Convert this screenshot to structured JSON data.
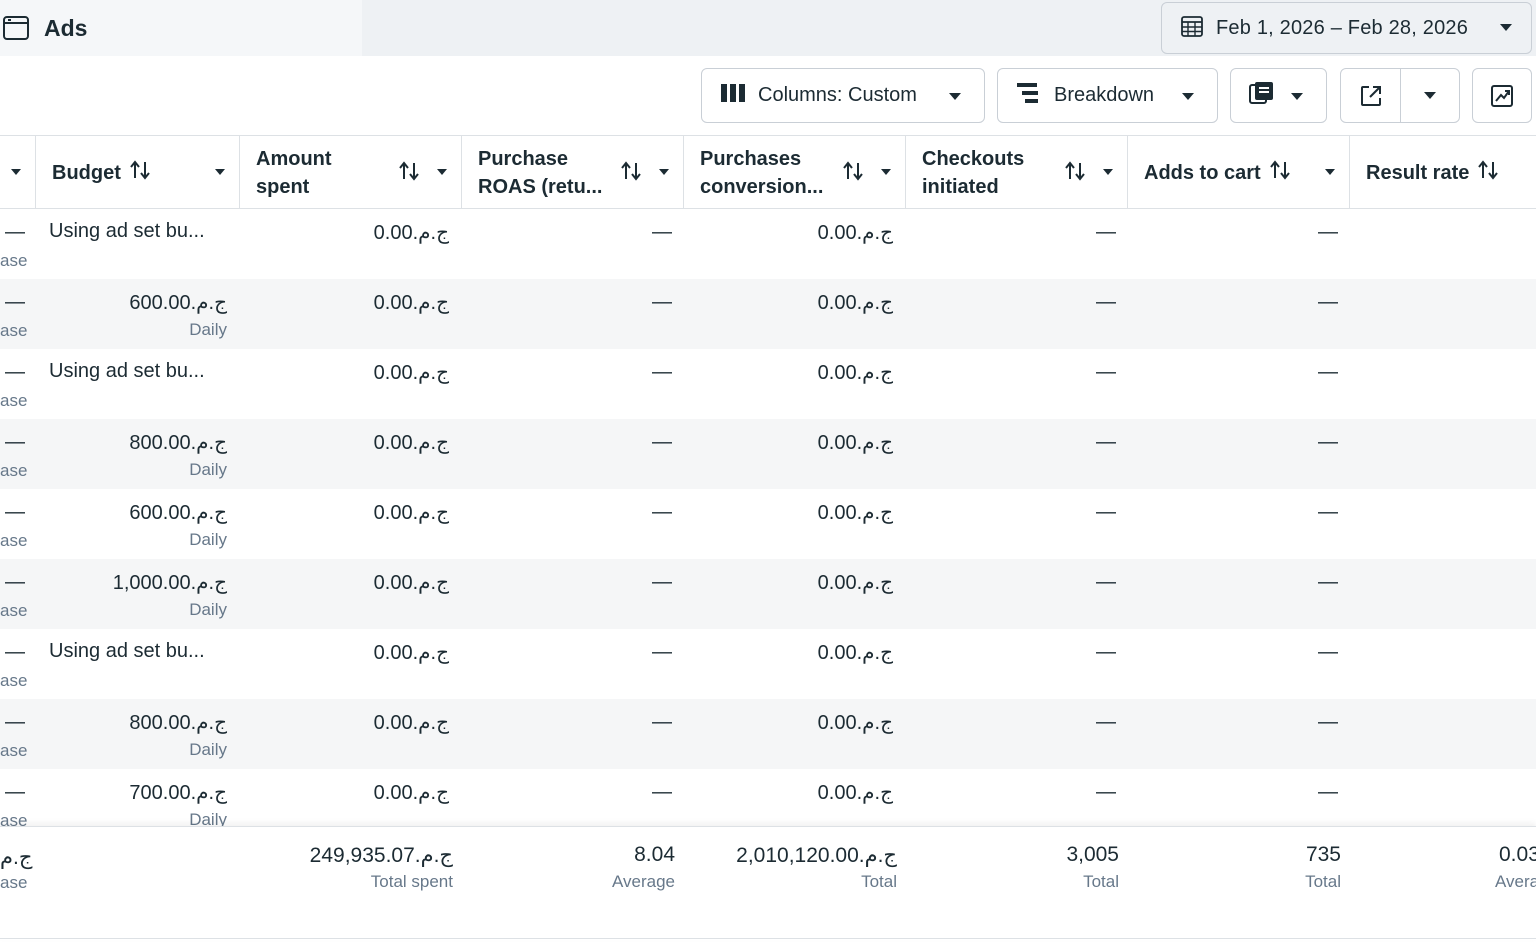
{
  "header": {
    "title": "Ads",
    "date_range": "Feb 1, 2026 – Feb 28, 2026"
  },
  "toolbar": {
    "columns_label": "Columns: Custom",
    "breakdown_label": "Breakdown"
  },
  "table": {
    "columns": [
      {
        "key": "budget",
        "label": "Budget"
      },
      {
        "key": "amount_spent",
        "label_line1": "Amount",
        "label_line2": "spent"
      },
      {
        "key": "purchase_roas",
        "label_line1": "Purchase",
        "label_line2": "ROAS (retu..."
      },
      {
        "key": "purchases_conversion",
        "label_line1": "Purchases",
        "label_line2": "conversion..."
      },
      {
        "key": "checkouts_initiated",
        "label_line1": "Checkouts",
        "label_line2": "initiated"
      },
      {
        "key": "adds_to_cart",
        "label": "Adds to cart"
      },
      {
        "key": "result_rate",
        "label": "Result rate"
      }
    ],
    "rows": [
      {
        "left_dash": "—",
        "left_sub": "ase",
        "budget": "Using ad set bu...",
        "budget_sub": "",
        "amount_spent": "0.00.ج.م",
        "purchase_roas": "—",
        "purchases_conversion": "0.00.ج.م",
        "checkouts_initiated": "—",
        "adds_to_cart": "—"
      },
      {
        "left_dash": "—",
        "left_sub": "ase",
        "budget": "600.00.ج.م",
        "budget_sub": "Daily",
        "amount_spent": "0.00.ج.م",
        "purchase_roas": "—",
        "purchases_conversion": "0.00.ج.م",
        "checkouts_initiated": "—",
        "adds_to_cart": "—"
      },
      {
        "left_dash": "—",
        "left_sub": "ase",
        "budget": "Using ad set bu...",
        "budget_sub": "",
        "amount_spent": "0.00.ج.م",
        "purchase_roas": "—",
        "purchases_conversion": "0.00.ج.م",
        "checkouts_initiated": "—",
        "adds_to_cart": "—"
      },
      {
        "left_dash": "—",
        "left_sub": "ase",
        "budget": "800.00.ج.م",
        "budget_sub": "Daily",
        "amount_spent": "0.00.ج.م",
        "purchase_roas": "—",
        "purchases_conversion": "0.00.ج.م",
        "checkouts_initiated": "—",
        "adds_to_cart": "—"
      },
      {
        "left_dash": "—",
        "left_sub": "ase",
        "budget": "600.00.ج.م",
        "budget_sub": "Daily",
        "amount_spent": "0.00.ج.م",
        "purchase_roas": "—",
        "purchases_conversion": "0.00.ج.م",
        "checkouts_initiated": "—",
        "adds_to_cart": "—"
      },
      {
        "left_dash": "—",
        "left_sub": "ase",
        "budget": "1,000.00.ج.م",
        "budget_sub": "Daily",
        "amount_spent": "0.00.ج.م",
        "purchase_roas": "—",
        "purchases_conversion": "0.00.ج.م",
        "checkouts_initiated": "—",
        "adds_to_cart": "—"
      },
      {
        "left_dash": "—",
        "left_sub": "ase",
        "budget": "Using ad set bu...",
        "budget_sub": "",
        "amount_spent": "0.00.ج.م",
        "purchase_roas": "—",
        "purchases_conversion": "0.00.ج.م",
        "checkouts_initiated": "—",
        "adds_to_cart": "—"
      },
      {
        "left_dash": "—",
        "left_sub": "ase",
        "budget": "800.00.ج.م",
        "budget_sub": "Daily",
        "amount_spent": "0.00.ج.م",
        "purchase_roas": "—",
        "purchases_conversion": "0.00.ج.م",
        "checkouts_initiated": "—",
        "adds_to_cart": "—"
      },
      {
        "left_dash": "—",
        "left_sub": "ase",
        "budget": "700.00.ج.م",
        "budget_sub": "Daily",
        "amount_spent": "0.00.ج.م",
        "purchase_roas": "—",
        "purchases_conversion": "0.00.ج.م",
        "checkouts_initiated": "—",
        "adds_to_cart": "—"
      }
    ],
    "totals": {
      "left_value": "ج.م",
      "left_sub": "ase",
      "amount_spent": "249,935.07.ج.م",
      "amount_spent_sub": "Total spent",
      "purchase_roas": "8.04",
      "purchase_roas_sub": "Average",
      "purchases_conversion": "2,010,120.00.ج.م",
      "purchases_conversion_sub": "Total",
      "checkouts_initiated": "3,005",
      "checkouts_initiated_sub": "Total",
      "adds_to_cart": "735",
      "adds_to_cart_sub": "Total",
      "result_rate": "0.03",
      "result_rate_sub": "Avera"
    }
  },
  "colors": {
    "text": "#1c2b33",
    "secondary_text": "#67788a",
    "border": "#dde1e5",
    "row_alt": "#f5f6f7",
    "topbar": "#eef1f4"
  }
}
